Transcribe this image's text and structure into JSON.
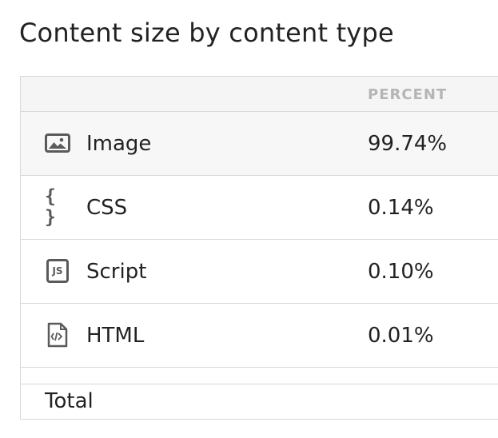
{
  "title": "Content size by content type",
  "table": {
    "columns": {
      "percent": "PERCENT"
    },
    "rows": [
      {
        "label": "Image",
        "percent": "99.74%",
        "icon": "image-icon"
      },
      {
        "label": "CSS",
        "percent": "0.14%",
        "icon": "css-braces-icon",
        "icon_text": "{ }"
      },
      {
        "label": "Script",
        "percent": "0.10%",
        "icon": "js-file-icon",
        "icon_text": "JS"
      },
      {
        "label": "HTML",
        "percent": "0.01%",
        "icon": "html-file-icon"
      }
    ],
    "total_label": "Total"
  },
  "colors": {
    "border": "#d9d9d9",
    "header_bg": "#f5f5f5",
    "header_text": "#b5b5b5",
    "icon": "#5a5a5a",
    "text": "#222222"
  }
}
